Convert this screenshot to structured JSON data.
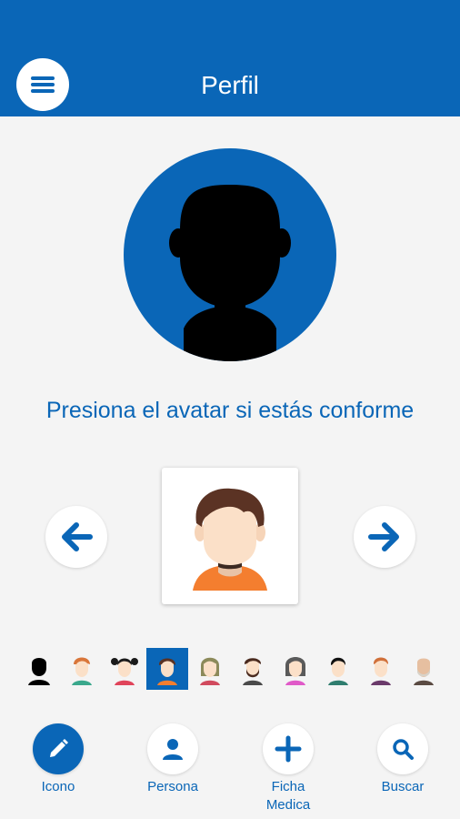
{
  "header": {
    "title": "Perfil",
    "menu_icon": "hamburger-menu-icon"
  },
  "prompt": "Presiona el avatar si estás conforme",
  "carousel": {
    "prev_icon": "arrow-left-icon",
    "next_icon": "arrow-right-icon"
  },
  "avatar_strip": {
    "selected_index": 3,
    "items": [
      "silhouette",
      "boy-orange-hair",
      "girl-black-pigtails",
      "boy-brown-hair",
      "woman-khaki-hair",
      "man-beard",
      "woman-gray-hair",
      "man-black-hair",
      "man-ginger",
      "bald-man"
    ]
  },
  "bottom_nav": {
    "items": [
      {
        "label": "Icono",
        "icon": "pencil-icon",
        "active": true
      },
      {
        "label": "Persona",
        "icon": "person-icon",
        "active": false
      },
      {
        "label": "Ficha\nMedica",
        "icon": "plus-icon",
        "active": false
      },
      {
        "label": "Buscar",
        "icon": "search-icon",
        "active": false
      }
    ]
  },
  "colors": {
    "primary": "#0a66b7",
    "background": "#f4f4f4",
    "white": "#ffffff"
  }
}
